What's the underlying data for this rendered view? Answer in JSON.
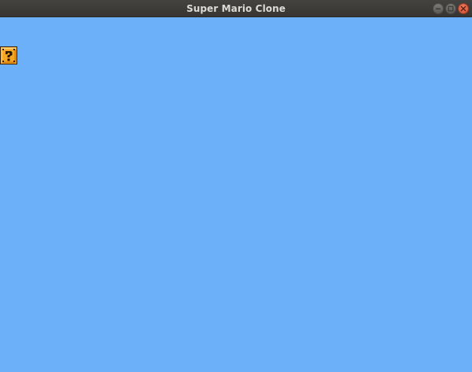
{
  "window": {
    "title": "Super Mario Clone",
    "controls": [
      {
        "name": "minimize",
        "icon": "minimize-icon"
      },
      {
        "name": "maximize",
        "icon": "maximize-icon"
      },
      {
        "name": "close",
        "icon": "close-icon"
      }
    ]
  },
  "game": {
    "sky_color": "#6bb0f8",
    "block_icon": "question-block-icon",
    "block_color": "#f5a623"
  }
}
